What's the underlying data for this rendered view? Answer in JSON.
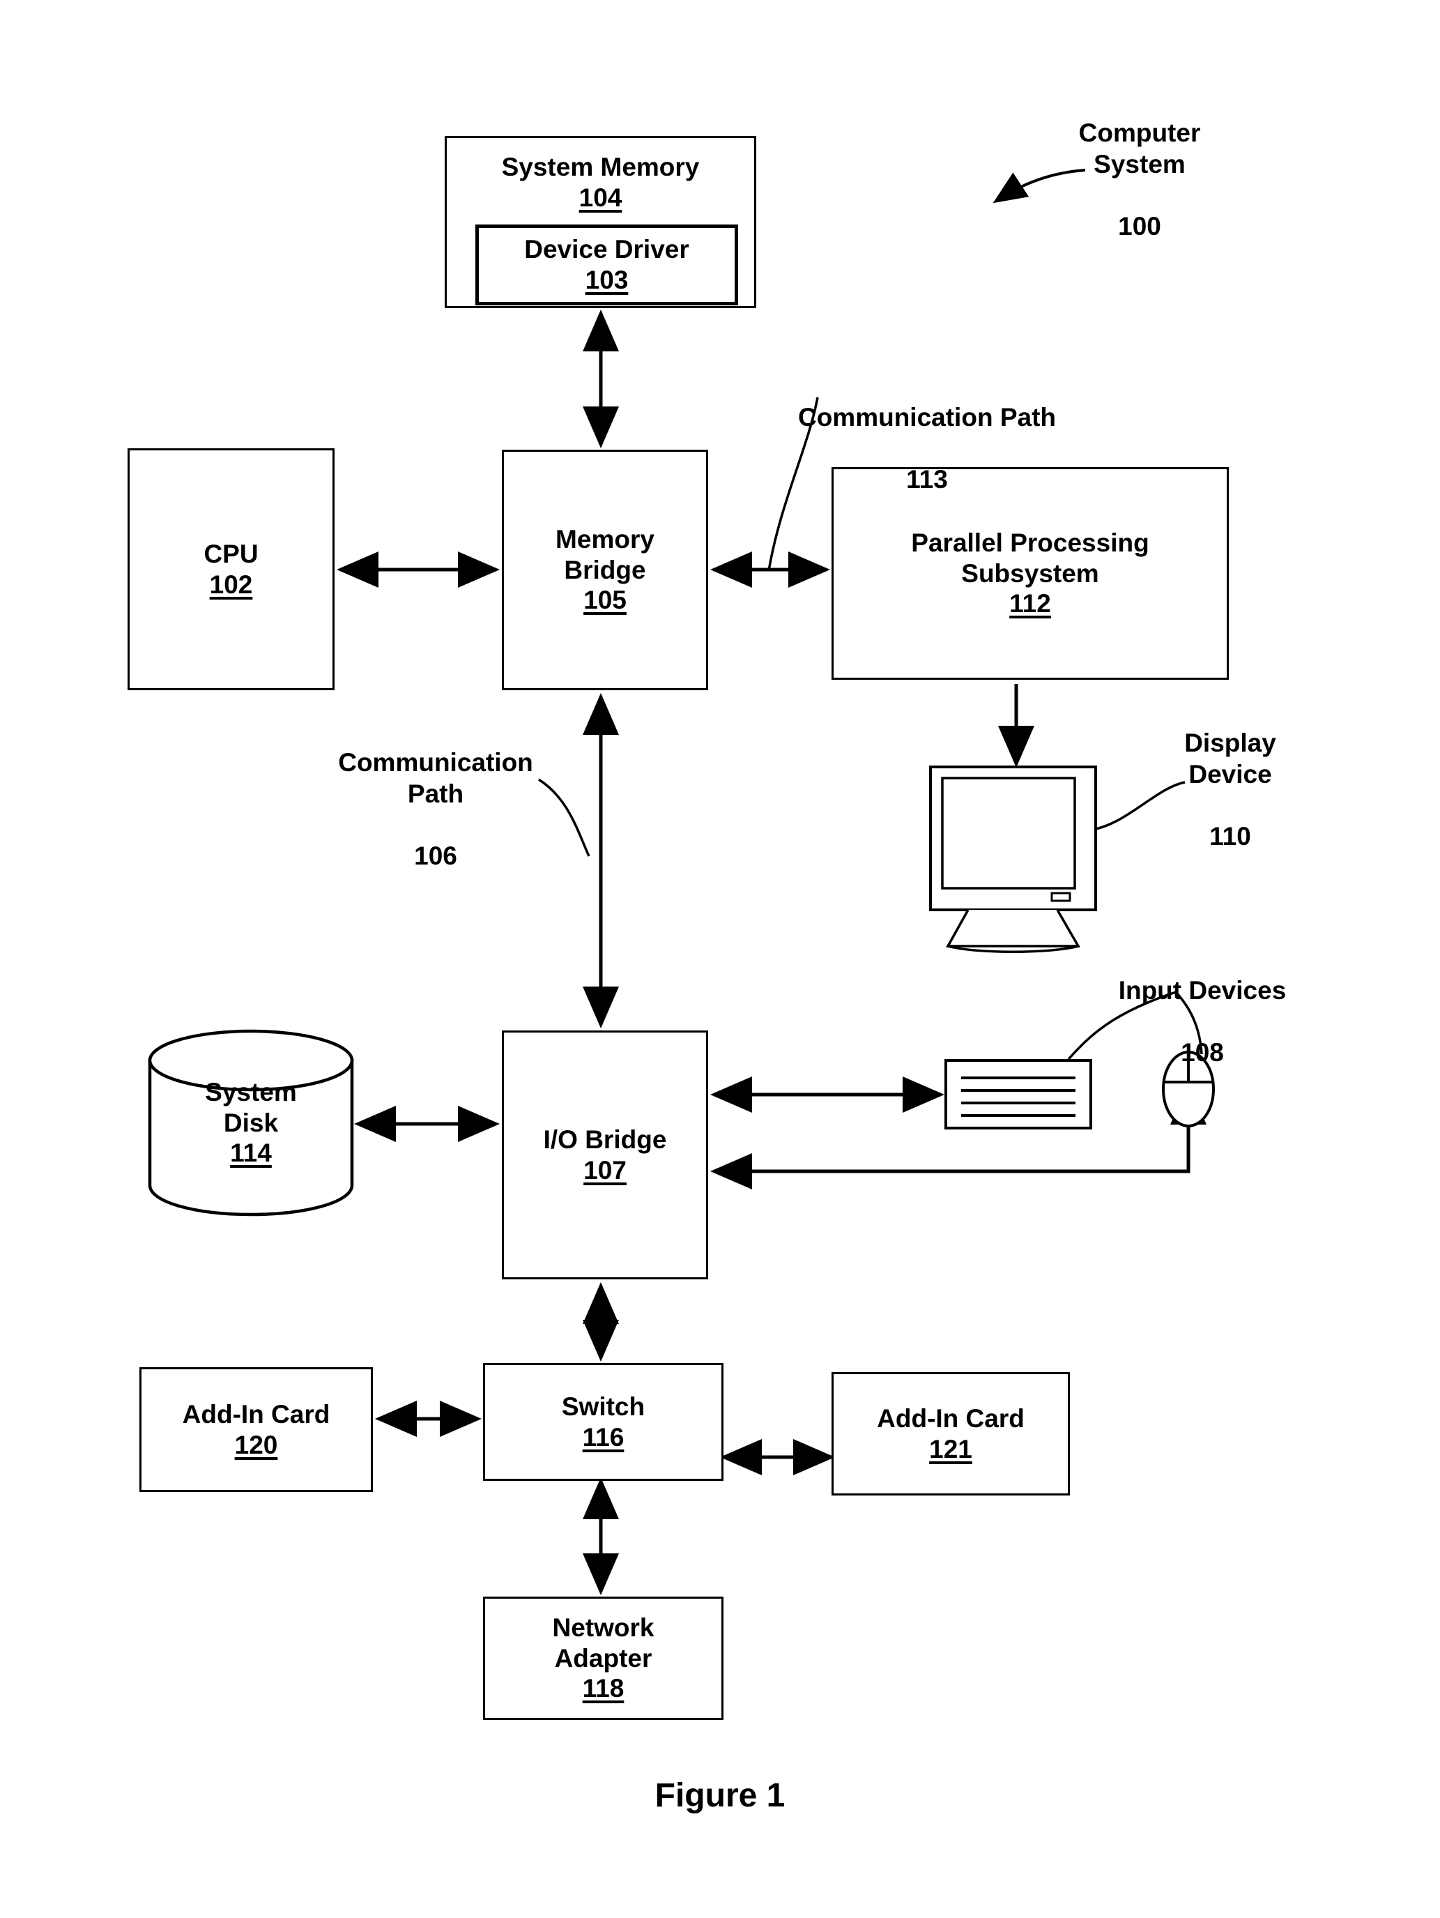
{
  "figure": {
    "caption": "Figure 1",
    "system_callout": {
      "label": "Computer\nSystem",
      "ref": "100"
    }
  },
  "nodes": [
    {
      "id": "system_memory",
      "title": "System Memory",
      "ref": "104"
    },
    {
      "id": "device_driver",
      "title": "Device Driver",
      "ref": "103"
    },
    {
      "id": "cpu",
      "title": "CPU",
      "ref": "102"
    },
    {
      "id": "memory_bridge",
      "title": "Memory\nBridge",
      "ref": "105"
    },
    {
      "id": "pps",
      "title": "Parallel Processing\nSubsystem",
      "ref": "112"
    },
    {
      "id": "io_bridge",
      "title": "I/O Bridge",
      "ref": "107"
    },
    {
      "id": "system_disk",
      "title": "System\nDisk",
      "ref": "114"
    },
    {
      "id": "add_in_card_120",
      "title": "Add-In Card",
      "ref": "120"
    },
    {
      "id": "switch",
      "title": "Switch",
      "ref": "116"
    },
    {
      "id": "add_in_card_121",
      "title": "Add-In Card",
      "ref": "121"
    },
    {
      "id": "network_adapter",
      "title": "Network\nAdapter",
      "ref": "118"
    }
  ],
  "callouts": {
    "comm_path_113": {
      "label": "Communication Path",
      "ref": "113"
    },
    "comm_path_106": {
      "label": "Communication\nPath",
      "ref": "106"
    },
    "display_device": {
      "label": "Display\nDevice",
      "ref": "110"
    },
    "input_devices": {
      "label": "Input Devices",
      "ref": "108"
    }
  },
  "icons": {
    "monitor": "display-monitor-icon",
    "keyboard": "keyboard-icon",
    "mouse": "mouse-icon",
    "disk": "cylinder-disk-icon"
  },
  "style": {
    "stroke": "#000000",
    "background": "#ffffff"
  }
}
